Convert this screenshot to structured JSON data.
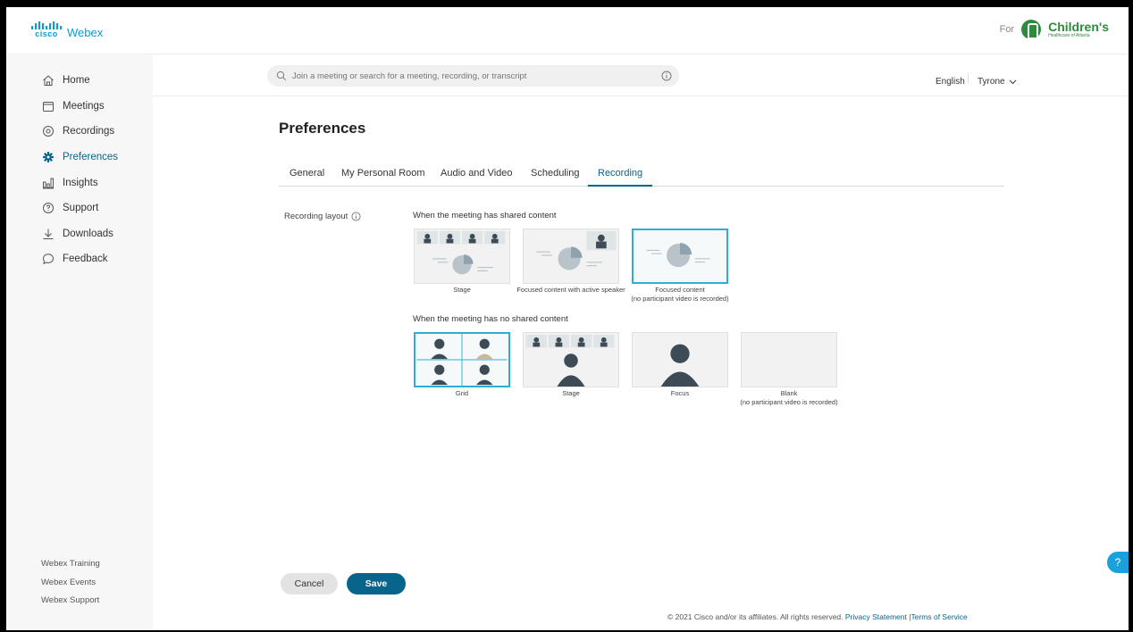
{
  "app": {
    "brand_cisco": "cisco",
    "brand_name": "Webex",
    "org_prefix": "For",
    "org_name": "Children's",
    "org_sub": "Healthcare of Atlanta"
  },
  "colors": {
    "accent": "#07658c",
    "selection": "#2ab0d8",
    "brand": "#049fd9",
    "org": "#2e8b3d"
  },
  "sidebar": {
    "items": [
      {
        "label": "Home",
        "icon": "home-icon"
      },
      {
        "label": "Meetings",
        "icon": "calendar-icon"
      },
      {
        "label": "Recordings",
        "icon": "recording-icon"
      },
      {
        "label": "Preferences",
        "icon": "gear-icon",
        "active": true
      },
      {
        "label": "Insights",
        "icon": "insights-icon"
      },
      {
        "label": "Support",
        "icon": "help-circle-icon"
      },
      {
        "label": "Downloads",
        "icon": "download-icon"
      },
      {
        "label": "Feedback",
        "icon": "chat-bubble-icon"
      }
    ],
    "links": [
      "Webex Training",
      "Webex Events",
      "Webex Support"
    ]
  },
  "search": {
    "placeholder": "Join a meeting or search for a meeting, recording, or transcript"
  },
  "header": {
    "language": "English",
    "user": "Tyrone"
  },
  "page": {
    "title": "Preferences"
  },
  "tabs": [
    {
      "label": "General"
    },
    {
      "label": "My Personal Room"
    },
    {
      "label": "Audio and Video"
    },
    {
      "label": "Scheduling"
    },
    {
      "label": "Recording",
      "active": true
    }
  ],
  "recording": {
    "label": "Recording layout",
    "shared_heading": "When the meeting has shared content",
    "shared_options": [
      {
        "name": "Stage",
        "note": ""
      },
      {
        "name": "Focused content with active speaker",
        "note": ""
      },
      {
        "name": "Focused content",
        "note": "(no participant video is recorded)",
        "selected": true
      }
    ],
    "noshared_heading": "When the meeting has no shared content",
    "noshared_options": [
      {
        "name": "Grid",
        "note": "",
        "selected": true
      },
      {
        "name": "Stage",
        "note": ""
      },
      {
        "name": "Focus",
        "note": ""
      },
      {
        "name": "Blank",
        "note": "(no participant video is recorded)"
      }
    ]
  },
  "buttons": {
    "cancel": "Cancel",
    "save": "Save"
  },
  "footer": {
    "copyright": "© 2021 Cisco and/or its affiliates. All rights reserved.",
    "privacy": "Privacy Statement",
    "separator": "|",
    "terms": "Terms of Service"
  },
  "help": {
    "label": "?"
  }
}
